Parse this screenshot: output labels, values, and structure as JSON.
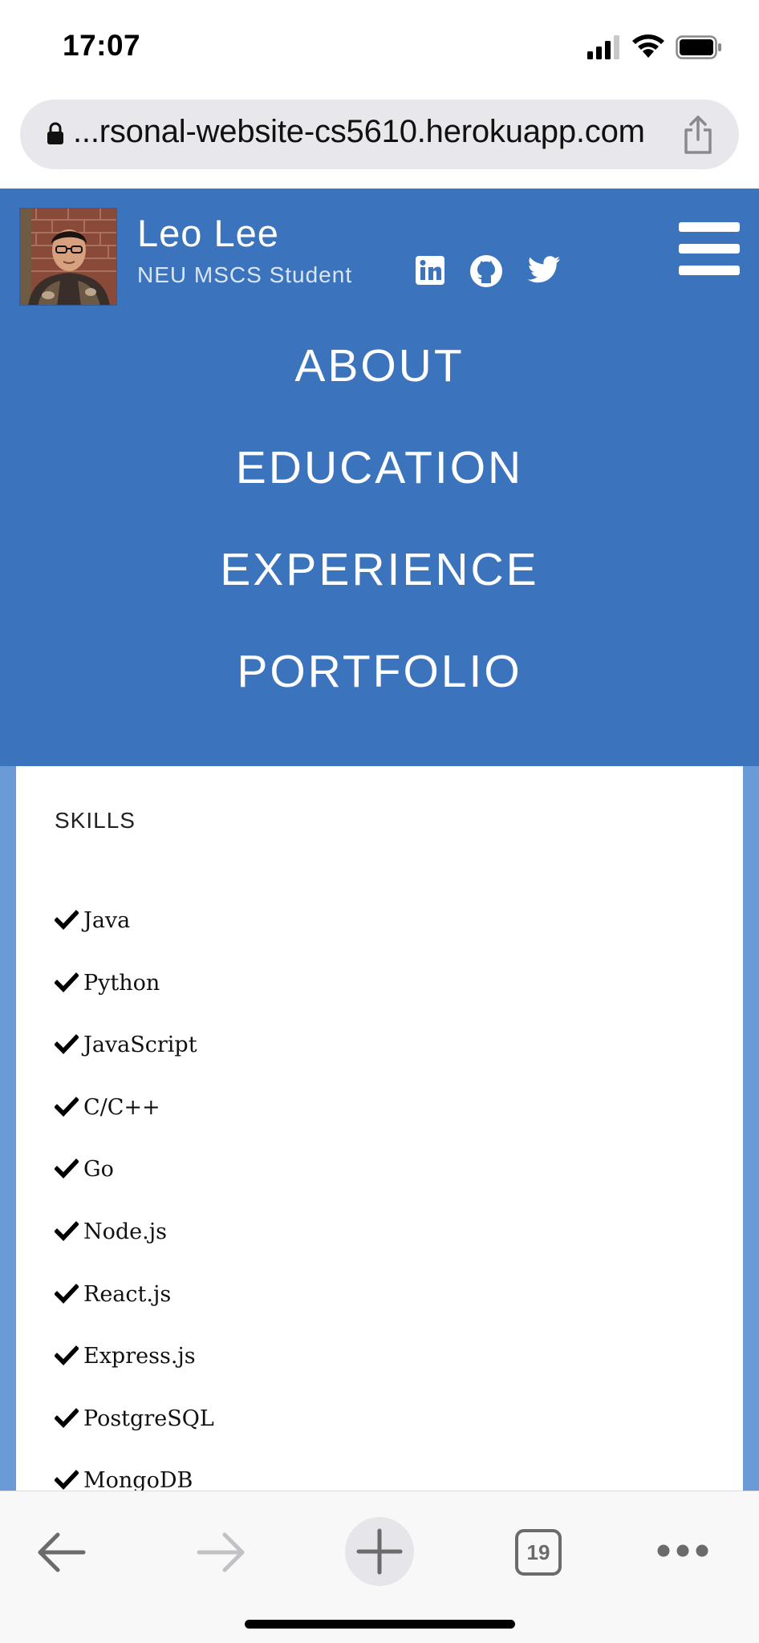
{
  "status_bar": {
    "time": "17:07"
  },
  "browser": {
    "url": "...rsonal-website-cs5610.herokuapp.com"
  },
  "site": {
    "name": "Leo Lee",
    "subtitle": "NEU MSCS Student",
    "nav": [
      "ABOUT",
      "EDUCATION",
      "EXPERIENCE",
      "PORTFOLIO"
    ],
    "header_color": "#3b74bc"
  },
  "skills": {
    "title": "SKILLS",
    "items": [
      "Java",
      "Python",
      "JavaScript",
      "C/C++",
      "Go",
      "Node.js",
      "React.js",
      "Express.js",
      "PostgreSQL",
      "MongoDB"
    ]
  },
  "toolbar": {
    "tab_count": "19"
  },
  "icons": {
    "social": [
      "linkedin-icon",
      "github-icon",
      "twitter-icon"
    ],
    "toolbar": [
      "back-arrow-icon",
      "forward-arrow-icon",
      "plus-icon",
      "tabs-icon",
      "more-icon"
    ]
  }
}
